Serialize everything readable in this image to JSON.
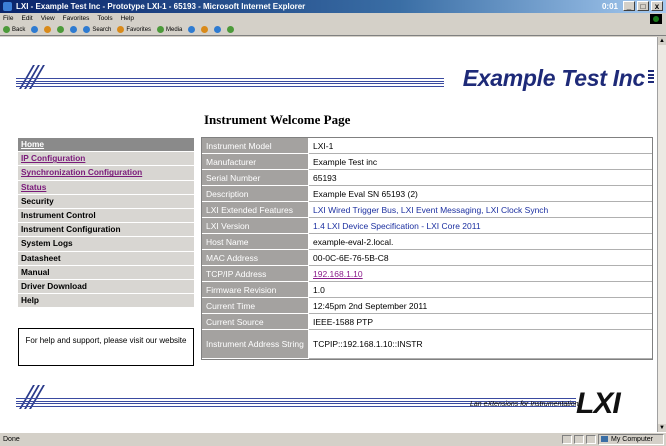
{
  "window": {
    "title": "LXI - Example Test Inc - Prototype LXI-1 - 65193 - Microsoft Internet Explorer",
    "tray_text": "0:01",
    "buttons": [
      "_",
      "□",
      "x"
    ]
  },
  "menubar": [
    "File",
    "Edit",
    "View",
    "Favorites",
    "Tools",
    "Help"
  ],
  "toolbar": {
    "back": "Back",
    "search": "Search",
    "favorites": "Favorites",
    "media": "Media"
  },
  "header": {
    "brand": "Example Test Inc"
  },
  "nav": {
    "items": [
      {
        "label": "Home",
        "state": "active"
      },
      {
        "label": "IP Configuration",
        "state": "link"
      },
      {
        "label": "Synchronization Configuration",
        "state": "link"
      },
      {
        "label": "Status",
        "state": "link"
      },
      {
        "label": "Security",
        "state": "plain"
      },
      {
        "label": "Instrument Control",
        "state": "plain"
      },
      {
        "label": "Instrument Configuration",
        "state": "plain"
      },
      {
        "label": "System Logs",
        "state": "plain"
      },
      {
        "label": "Datasheet",
        "state": "plain"
      },
      {
        "label": "Manual",
        "state": "plain"
      },
      {
        "label": "Driver Download",
        "state": "plain"
      },
      {
        "label": "Help",
        "state": "plain"
      }
    ],
    "help_text": "For help and support, please visit our website"
  },
  "main": {
    "title": "Instrument Welcome Page",
    "rows": [
      {
        "key": "Instrument Model",
        "value": "LXI-1"
      },
      {
        "key": "Manufacturer",
        "value": "Example Test inc"
      },
      {
        "key": "Serial Number",
        "value": "65193"
      },
      {
        "key": "Description",
        "value": "Example Eval SN 65193 (2)"
      },
      {
        "key": "LXI Extended Features",
        "value": "LXI Wired Trigger Bus, LXI Event Messaging, LXI Clock Synch"
      },
      {
        "key": "LXI Version",
        "value": "1.4 LXI Device Specification - LXI Core 2011"
      },
      {
        "key": "Host Name",
        "value": "example-eval-2.local."
      },
      {
        "key": "MAC Address",
        "value": "00-0C-6E-76-5B-C8"
      },
      {
        "key": "TCP/IP Address",
        "value": "192.168.1.10"
      },
      {
        "key": "Firmware Revision",
        "value": "1.0"
      },
      {
        "key": "Current Time",
        "value": "12:45pm 2nd September 2011"
      },
      {
        "key": "Current Source",
        "value": "IEEE-1588 PTP"
      },
      {
        "key": "Instrument Address String",
        "value": "TCPIP::192.168.1.10::INSTR"
      }
    ]
  },
  "footer": {
    "tagline": "Lan eXtensions for Instrumentation",
    "logo": "LXI"
  },
  "statusbar": {
    "left": "Done",
    "zone": "My Computer"
  },
  "colors": {
    "brand_blue": "#1e2a78",
    "key_cell": "#a4a2a0",
    "visited_link": "#7a1a7a"
  }
}
